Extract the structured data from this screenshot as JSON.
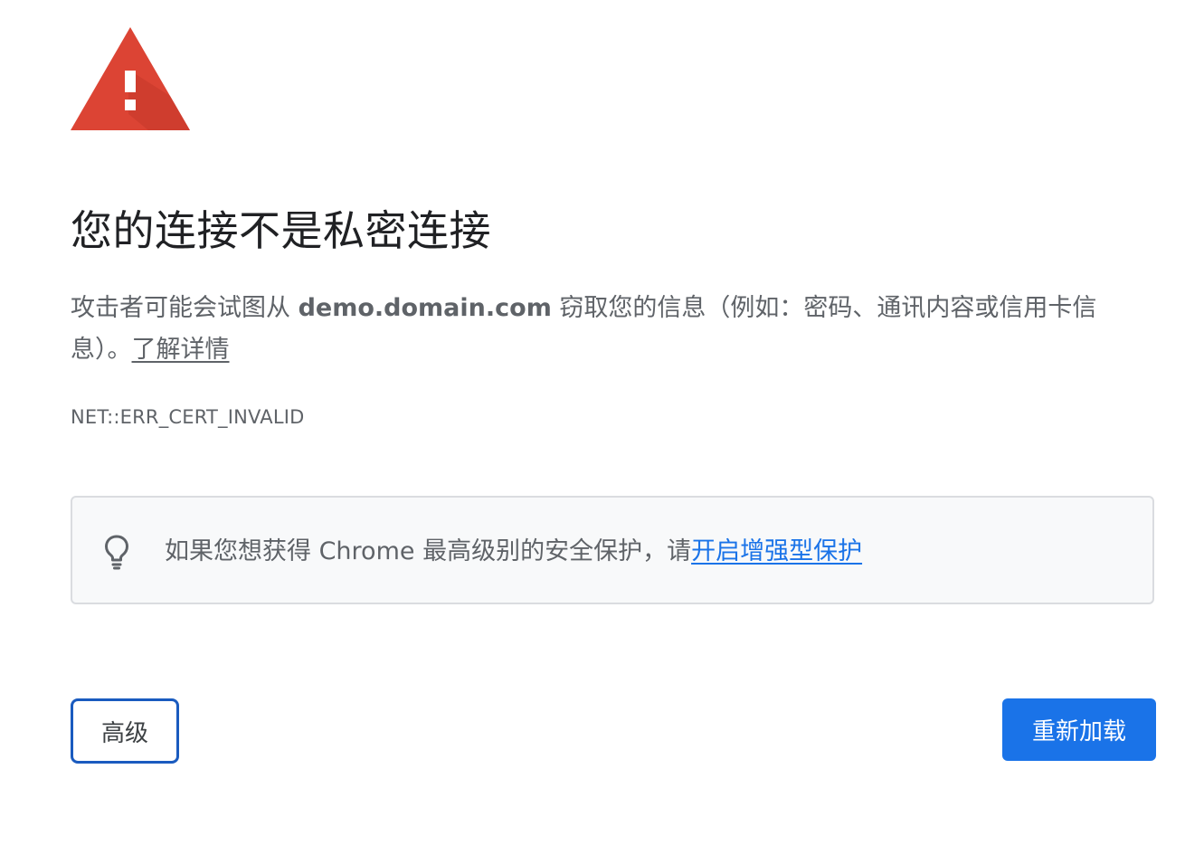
{
  "icons": {
    "warning": "warning-triangle-icon",
    "bulb": "lightbulb-icon"
  },
  "colors": {
    "warning_red": "#dc4434",
    "accent_blue": "#1a73e8",
    "text_gray": "#5f6368",
    "box_bg": "#f8f9fa"
  },
  "title": "您的连接不是私密连接",
  "explanation": {
    "prefix": "攻击者可能会试图从 ",
    "host": "demo.domain.com",
    "suffix": " 窃取您的信息（例如：密码、通讯内容或信用卡信息）。",
    "learn_more": "了解详情"
  },
  "error_code": "NET::ERR_CERT_INVALID",
  "promo": {
    "text": "如果您想获得 Chrome 最高级别的安全保护，请",
    "link": "开启增强型保护"
  },
  "buttons": {
    "advanced": "高级",
    "reload": "重新加载"
  }
}
